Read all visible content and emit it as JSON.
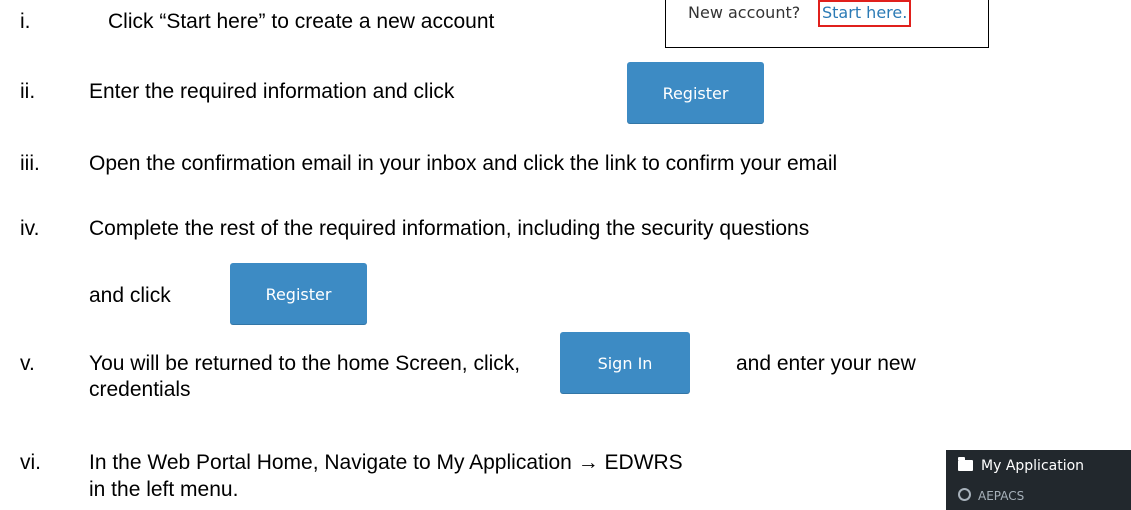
{
  "steps": [
    {
      "num": "i.",
      "text": "Click “Start here” to create a new account"
    },
    {
      "num": "ii.",
      "text": "Enter the required information and click"
    },
    {
      "num": "iii.",
      "text": "Open the confirmation email in your inbox and click the link to confirm your email"
    },
    {
      "num": "iv.",
      "text": "Complete the rest of the required information, including the security questions",
      "text2": "and click"
    },
    {
      "num": "v.",
      "text": "You will be returned to the home Screen, click,",
      "text_after": "and enter your new",
      "text2": "credentials"
    },
    {
      "num": "vi.",
      "text": "In the Web Portal Home, Navigate to My Application → EDWRS",
      "text2": "in the left menu."
    }
  ],
  "inset": {
    "question": "New account?",
    "link": "Start here."
  },
  "buttons": {
    "register": "Register",
    "sign_in": "Sign In"
  },
  "menu": {
    "parent": "My Application",
    "child": "AEPACS"
  },
  "colors": {
    "button": "#3d8bc4",
    "link": "#2a7ab5",
    "highlight": "#e0201c",
    "menu_bg": "#22282d"
  }
}
